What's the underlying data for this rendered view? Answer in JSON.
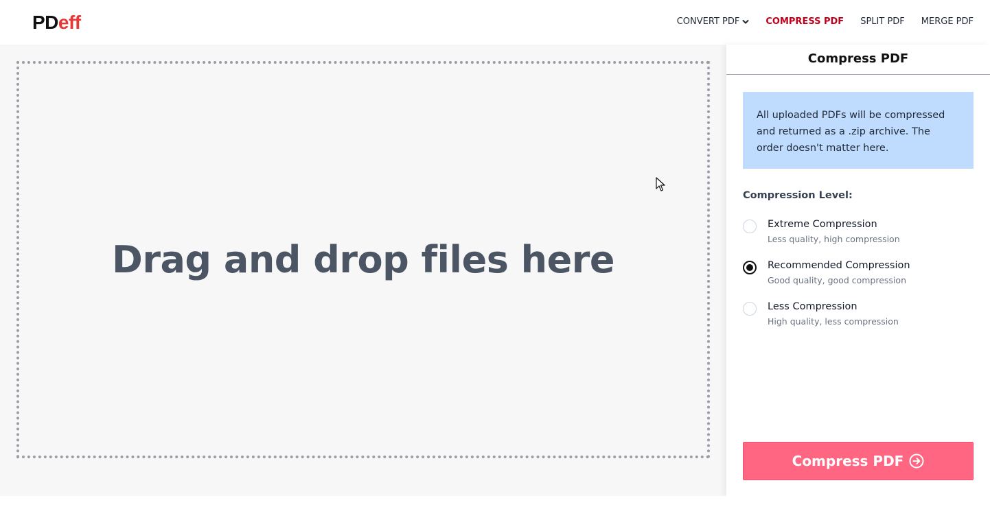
{
  "brand": {
    "logo_part1": "PD",
    "logo_part2": "eff"
  },
  "nav": {
    "convert": "CONVERT PDF",
    "compress": "COMPRESS PDF",
    "split": "SPLIT PDF",
    "merge": "MERGE PDF",
    "active_color": "#c0001a"
  },
  "dropzone": {
    "text": "Drag and drop files here"
  },
  "sidebar": {
    "title": "Compress PDF",
    "info": "All uploaded PDFs will be compressed and returned as a .zip archive. The order doesn't matter here.",
    "level_label": "Compression Level:",
    "options": [
      {
        "title": "Extreme Compression",
        "desc": "Less quality, high compression",
        "selected": false
      },
      {
        "title": "Recommended Compression",
        "desc": "Good quality, good compression",
        "selected": true
      },
      {
        "title": "Less Compression",
        "desc": "High quality, less compression",
        "selected": false
      }
    ],
    "button_label": "Compress PDF",
    "button_icon": "arrow-right-circle-icon",
    "button_color": "#ff6682",
    "info_bg": "#bfdbfe"
  }
}
